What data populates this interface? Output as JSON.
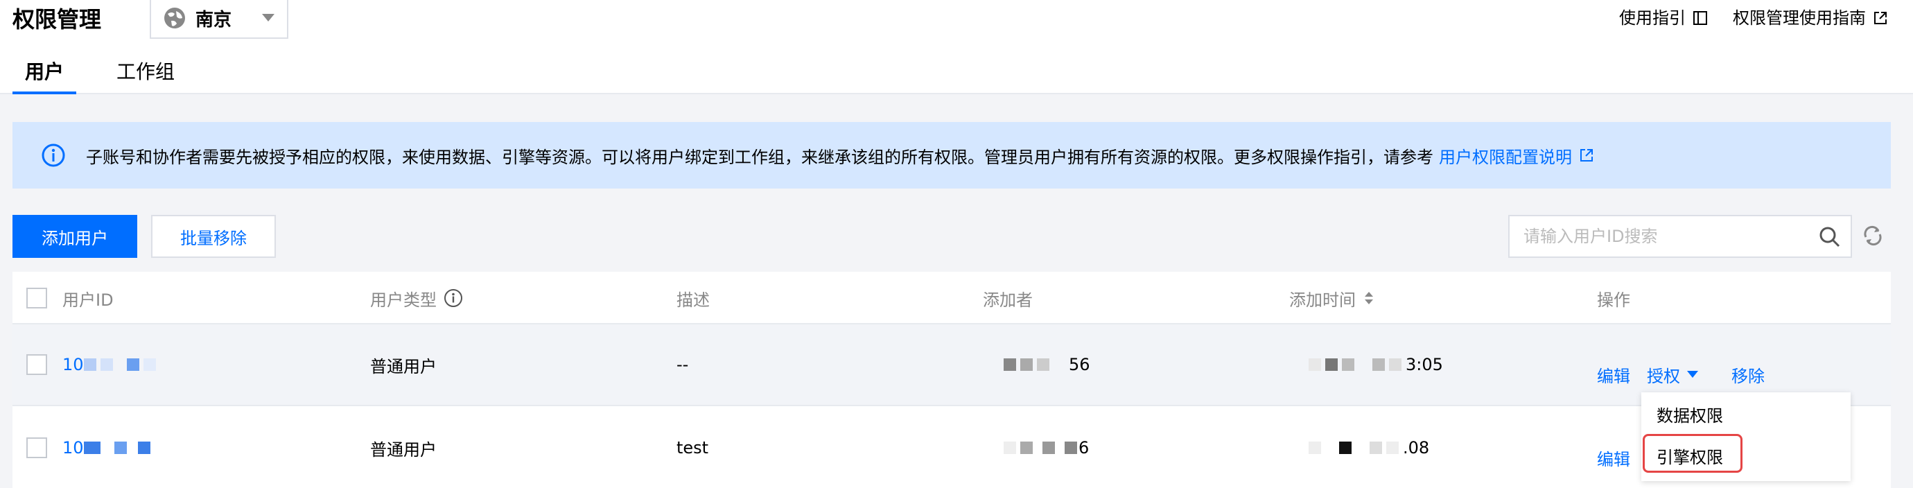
{
  "header": {
    "title": "权限管理",
    "region": "南京",
    "links": [
      {
        "label": "使用指引",
        "icon": "book-icon"
      },
      {
        "label": "权限管理使用指南",
        "icon": "external-link-icon"
      }
    ]
  },
  "tabs": [
    {
      "label": "用户",
      "active": true
    },
    {
      "label": "工作组",
      "active": false
    }
  ],
  "notice": {
    "text": "子账号和协作者需要先被授予相应的权限，来使用数据、引擎等资源。可以将用户绑定到工作组，来继承该组的所有权限。管理员用户拥有所有资源的权限。更多权限操作指引，请参考",
    "link_text": "用户权限配置说明"
  },
  "toolbar": {
    "add_user": "添加用户",
    "batch_remove": "批量移除",
    "search_placeholder": "请输入用户ID搜索"
  },
  "table": {
    "columns": [
      "用户ID",
      "用户类型",
      "描述",
      "添加者",
      "添加时间",
      "操作"
    ],
    "rows": [
      {
        "user_id": "10",
        "user_type": "普通用户",
        "description": "--",
        "added_by": "56",
        "added_time": "3:05"
      },
      {
        "user_id": "10",
        "user_type": "普通用户",
        "description": "test",
        "added_by": "6",
        "added_time": ".08"
      }
    ],
    "actions": {
      "edit": "编辑",
      "grant": "授权",
      "remove": "移除"
    }
  },
  "dropdown": {
    "items": [
      "数据权限",
      "引擎权限"
    ]
  },
  "colors": {
    "accent": "#006eff",
    "notice_bg": "#d5e7ff",
    "highlight": "#e54545"
  }
}
